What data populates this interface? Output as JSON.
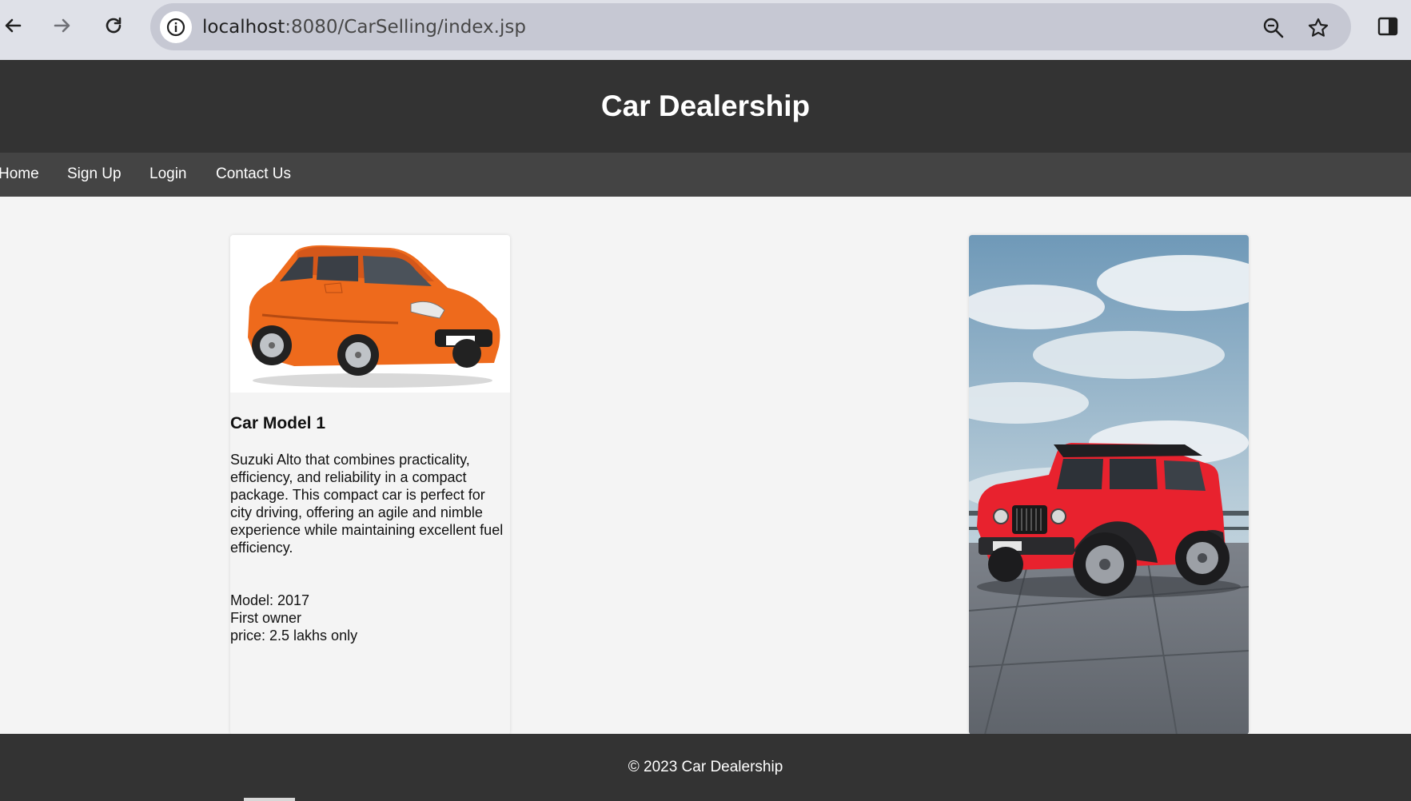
{
  "browser": {
    "url_host": "localhost",
    "url_path": ":8080/CarSelling/index.jsp",
    "back_icon": "back-arrow-icon",
    "forward_icon": "forward-arrow-icon",
    "reload_icon": "reload-icon",
    "info_icon": "info-icon",
    "zoom_icon": "zoom-icon",
    "bookmark_icon": "star-icon",
    "sidebar_icon": "side-panel-icon"
  },
  "header": {
    "title": "Car Dealership"
  },
  "nav": {
    "items": [
      {
        "label": "Home"
      },
      {
        "label": "Sign Up"
      },
      {
        "label": "Login"
      },
      {
        "label": "Contact Us"
      }
    ]
  },
  "cards": [
    {
      "title": "Car Model 1",
      "description": "Suzuki Alto that combines practicality, efficiency, and reliability in a compact package. This compact car is perfect for city driving, offering an agile and nimble experience while maintaining excellent fuel efficiency.",
      "details": [
        "Model: 2017",
        "First owner",
        "price: 2.5 lakhs only"
      ],
      "image_name": "orange-hatchback-car"
    },
    {
      "image_name": "red-suv-car"
    }
  ],
  "footer": {
    "text": "© 2023 Car Dealership"
  },
  "colors": {
    "header_bg": "#333333",
    "nav_bg": "#444444",
    "page_bg": "#f4f4f4",
    "car1_body": "#ee6a1c",
    "car2_body": "#e8222e"
  }
}
